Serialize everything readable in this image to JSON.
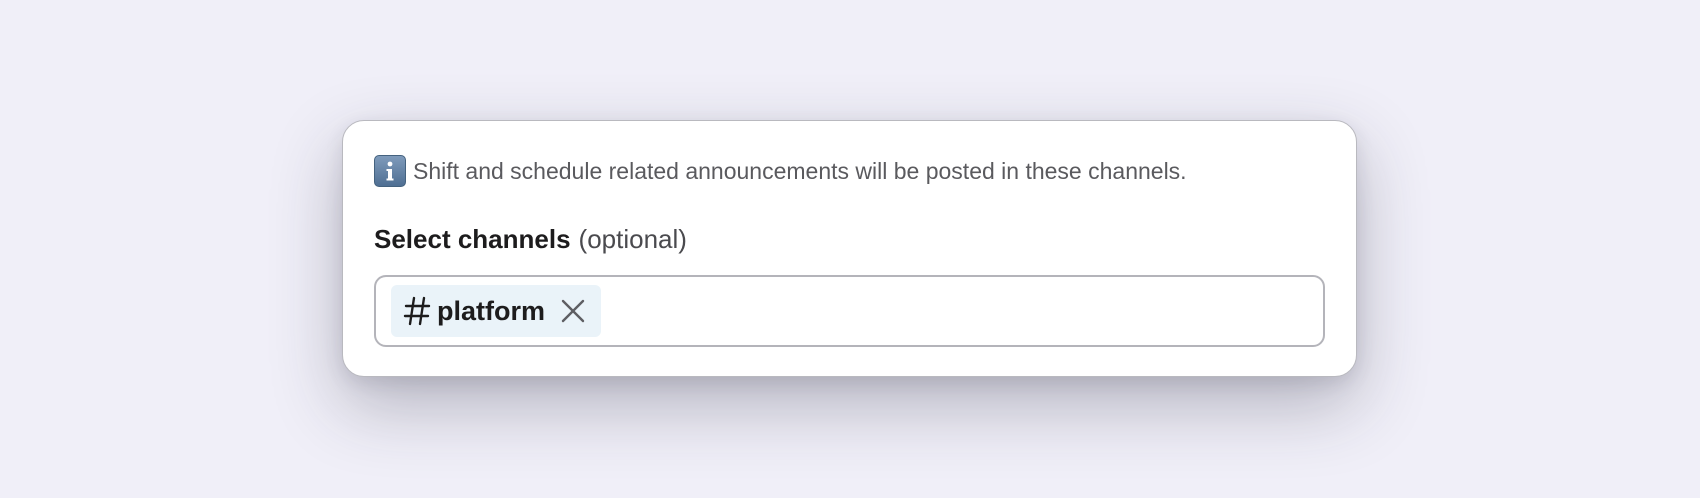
{
  "info": {
    "icon": "info-icon",
    "text": "Shift and schedule related announcements will be posted in these channels."
  },
  "field": {
    "label": "Select channels",
    "optional_label": "(optional)"
  },
  "selected_channels": [
    {
      "icon": "hash-icon",
      "name": "platform",
      "remove_icon": "close-icon"
    }
  ],
  "colors": {
    "background": "#f0eff8",
    "card": "#ffffff",
    "chip": "#eaf3f9",
    "info_icon": "#5f7fa3",
    "text_primary": "#1d1c1d",
    "text_secondary": "#5a5a5e"
  }
}
